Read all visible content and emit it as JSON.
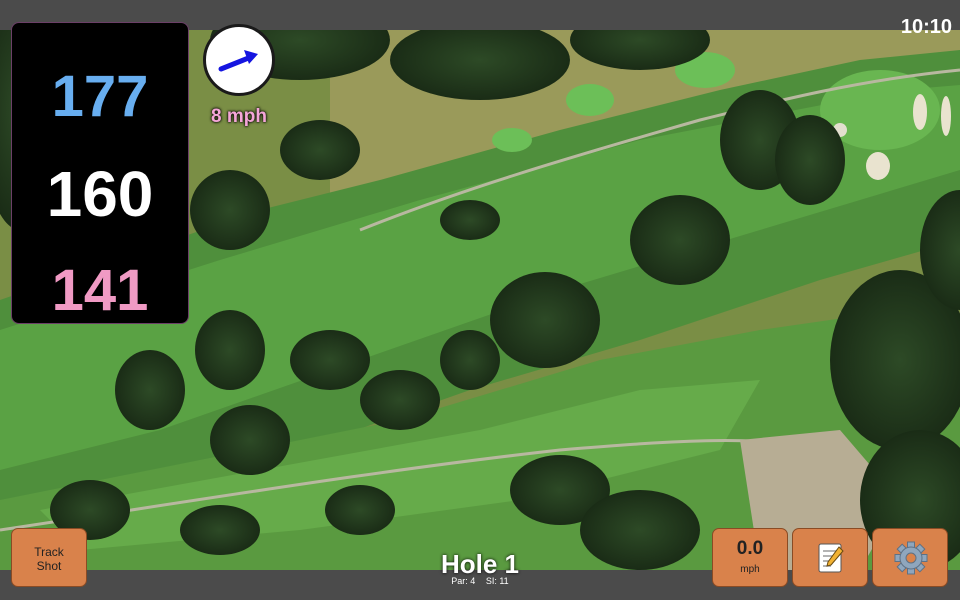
{
  "status": {
    "time": "10:10"
  },
  "distances": {
    "back": "177",
    "center": "160",
    "front": "141"
  },
  "wind": {
    "speed": "8 mph",
    "icon": "wind-arrow-icon"
  },
  "buttons": {
    "track_shot_line1": "Track",
    "track_shot_line2": "Shot",
    "speed_value": "0.0",
    "speed_unit": "mph",
    "notes_icon": "memo-icon",
    "settings_icon": "gear-icon"
  },
  "hole": {
    "title": "Hole 1",
    "par": "Par: 4",
    "si": "SI: 11"
  },
  "colors": {
    "back": "#68aef0",
    "center": "#ffffff",
    "front": "#f09ac4",
    "button": "#d9824b",
    "wind_text": "#f5a6d8"
  }
}
